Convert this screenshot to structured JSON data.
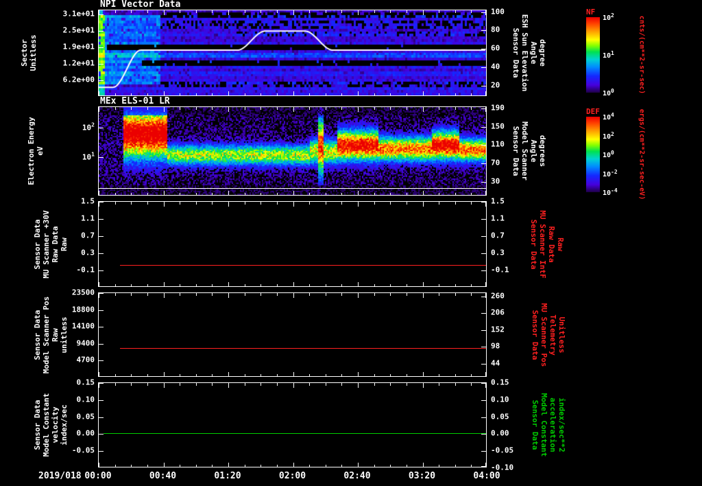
{
  "page": {
    "background": "#000000",
    "foreground": "#ffffff"
  },
  "x_axis": {
    "date_label": "2019/018",
    "tick_labels": [
      "00:00",
      "00:40",
      "01:20",
      "02:00",
      "02:40",
      "03:20",
      "04:00"
    ],
    "t_start_min": 0,
    "t_end_min": 240
  },
  "chart_data": [
    {
      "id": "npi",
      "type": "heatmap",
      "title": "NPI Vector Data",
      "left_axis": {
        "label_lines": [
          "Sector",
          "Unitless"
        ],
        "min": 0,
        "max": 32.5,
        "color": "#ffffff",
        "ticks": [
          {
            "v": 31.0,
            "label": "3.1e+01"
          },
          {
            "v": 24.8,
            "label": "2.5e+01"
          },
          {
            "v": 18.6,
            "label": "1.9e+01"
          },
          {
            "v": 12.4,
            "label": "1.2e+01"
          },
          {
            "v": 6.2,
            "label": "6.2e+00"
          }
        ]
      },
      "right_axis": {
        "label_lines": [
          "Sensor Data",
          "ESH Sun Elevation",
          "Angle",
          "degree"
        ],
        "min": 8,
        "max": 102,
        "color": "#ffffff",
        "ticks": [
          {
            "v": 100,
            "label": "100"
          },
          {
            "v": 80,
            "label": "80"
          },
          {
            "v": 60,
            "label": "60"
          },
          {
            "v": 40,
            "label": "40"
          },
          {
            "v": 20,
            "label": "20"
          }
        ]
      },
      "overlay_line": {
        "color": "#ffffff",
        "axis": "right",
        "points": [
          [
            0,
            17
          ],
          [
            9,
            17
          ],
          [
            26,
            58
          ],
          [
            86,
            58
          ],
          [
            103,
            79
          ],
          [
            128,
            79
          ],
          [
            145,
            58
          ],
          [
            240,
            58
          ]
        ]
      },
      "heatmap": {
        "rows": 32,
        "base": 0.17,
        "noise": 0.07,
        "edge_bright": {
          "t_end": 0.014,
          "boost": 0.38
        },
        "left_bright": {
          "t_end": 0.155,
          "boost": 0.2,
          "row_start": 2,
          "row_end": 28
        },
        "bright_rows": [
          {
            "r0": 0.49,
            "r1": 0.57,
            "boost": 0.16
          },
          {
            "r0": 0.72,
            "r1": 0.79,
            "boost": 0.1
          }
        ],
        "black_bands": [
          {
            "r0": 0.405,
            "r1": 0.475,
            "t0": 0.02,
            "t1": 1.0,
            "holes": 0.02
          },
          {
            "r0": 0.585,
            "r1": 0.67,
            "t0": 0.11,
            "t1": 1.0,
            "holes": 0.06
          },
          {
            "r0": 0.03,
            "r1": 0.1,
            "t0": 0.155,
            "t1": 1.0,
            "holes": 0.3
          },
          {
            "r0": 0.13,
            "r1": 0.23,
            "t0": 0.155,
            "t1": 1.0,
            "holes": 0.6
          },
          {
            "r0": 0.25,
            "r1": 0.3,
            "t0": 0.35,
            "t1": 1.0,
            "holes": 0.75
          },
          {
            "r0": 0.84,
            "r1": 0.91,
            "t0": 0.155,
            "t1": 1.0,
            "holes": 0.55
          }
        ],
        "speckle": 0.05,
        "color_scale": 0.8
      }
    },
    {
      "id": "els",
      "type": "heatmap",
      "title": "MEx ELS-01 LR",
      "left_axis": {
        "label_lines": [
          "Electron Energy",
          "eV"
        ],
        "log": true,
        "min_exp": -0.33,
        "max_exp": 2.7,
        "color": "#ffffff",
        "ticks": [
          {
            "base": "10",
            "exp": "2"
          },
          {
            "base": "10",
            "exp": "1"
          }
        ]
      },
      "right_axis": {
        "label_lines": [
          "Sensor Data",
          "Model Scanner",
          "Angle",
          "degrees"
        ],
        "min": -2,
        "max": 193,
        "color": "#ffffff",
        "ticks": [
          {
            "v": 190,
            "label": "190"
          },
          {
            "v": 150,
            "label": "150"
          },
          {
            "v": 110,
            "label": "110"
          },
          {
            "v": 70,
            "label": "70"
          },
          {
            "v": 30,
            "label": "30"
          }
        ]
      },
      "white_line": {
        "frac": 0.905,
        "color": "#ffffff"
      },
      "heatmap": {
        "bg": 0.06,
        "noise": 0.16,
        "top_dim_frac": 0.08,
        "bottom_dim_frac": 0.88,
        "segments": [
          {
            "t0": 0.0,
            "t1": 0.062,
            "amp": 0.02,
            "center": 0.5,
            "width": 0.4
          },
          {
            "t0": 0.062,
            "t1": 0.175,
            "amp": 1.05,
            "center": 0.3,
            "width": 0.26
          },
          {
            "t0": 0.175,
            "t1": 0.545,
            "amp": 0.6,
            "center": 0.54,
            "width": 0.11
          },
          {
            "t0": 0.545,
            "t1": 0.615,
            "amp": 0.66,
            "center": 0.5,
            "width": 0.13
          },
          {
            "t0": 0.563,
            "t1": 0.58,
            "amp": 0.9,
            "center": 0.45,
            "width": 0.3
          },
          {
            "t0": 0.615,
            "t1": 0.72,
            "amp": 0.97,
            "center": 0.43,
            "width": 0.16
          },
          {
            "t0": 0.72,
            "t1": 0.86,
            "amp": 0.8,
            "center": 0.47,
            "width": 0.13
          },
          {
            "t0": 0.86,
            "t1": 0.93,
            "amp": 1.0,
            "center": 0.43,
            "width": 0.15
          },
          {
            "t0": 0.93,
            "t1": 1.0,
            "amp": 0.82,
            "center": 0.48,
            "width": 0.12
          }
        ]
      }
    },
    {
      "id": "mu-scanner-30v",
      "type": "line",
      "title": "",
      "left_axis": {
        "label_lines": [
          "Sensor Data",
          "MU Scanner +30V",
          "Raw Data",
          "Raw"
        ],
        "min": -0.5,
        "max": 1.5,
        "color": "#ffffff",
        "ticks": [
          {
            "v": 1.5,
            "label": "1.5"
          },
          {
            "v": 1.1,
            "label": "1.1"
          },
          {
            "v": 0.7,
            "label": "0.7"
          },
          {
            "v": 0.3,
            "label": "0.3"
          },
          {
            "v": -0.1,
            "label": "-0.1"
          }
        ]
      },
      "right_axis": {
        "label_lines": [
          "Sensor Data",
          "MU Scanner IntF",
          "Raw Data",
          "Raw"
        ],
        "min": -0.5,
        "max": 1.5,
        "color": "#ff2020",
        "ticks": [
          {
            "v": 1.5,
            "label": "1.5"
          },
          {
            "v": 1.1,
            "label": "1.1"
          },
          {
            "v": 0.7,
            "label": "0.7"
          },
          {
            "v": 0.3,
            "label": "0.3"
          },
          {
            "v": -0.1,
            "label": "-0.1"
          }
        ]
      },
      "series": [
        {
          "name": "raw",
          "color": "#ff2020",
          "value": 0.0,
          "t_start": 13,
          "t_end": 240
        }
      ]
    },
    {
      "id": "model-scanner-pos",
      "type": "line",
      "title": "",
      "left_axis": {
        "label_lines": [
          "Sensor Data",
          "Model Scanner Pos",
          "Raw",
          "unitless"
        ],
        "min": 0,
        "max": 23500,
        "color": "#ffffff",
        "ticks": [
          {
            "v": 23500,
            "label": "23500"
          },
          {
            "v": 18800,
            "label": "18800"
          },
          {
            "v": 14100,
            "label": "14100"
          },
          {
            "v": 9400,
            "label": "9400"
          },
          {
            "v": 4700,
            "label": "4700"
          }
        ]
      },
      "right_axis": {
        "label_lines": [
          "Sensor Data",
          "MU Scanner Pos",
          "Telemetry",
          "Unitless"
        ],
        "min": 0,
        "max": 270,
        "color": "#ff2020",
        "ticks": [
          {
            "v": 260,
            "label": "260"
          },
          {
            "v": 206,
            "label": "206"
          },
          {
            "v": 152,
            "label": "152"
          },
          {
            "v": 98,
            "label": "98"
          },
          {
            "v": 44,
            "label": "44"
          }
        ]
      },
      "series": [
        {
          "name": "pos",
          "color": "#ff2020",
          "value": 8000,
          "t_start": 13,
          "t_end": 240
        }
      ]
    },
    {
      "id": "model-constant",
      "type": "line",
      "title": "",
      "left_axis": {
        "label_lines": [
          "Sensor Data",
          "Model Constant",
          "velocity",
          "index/sec"
        ],
        "min": -0.1,
        "max": 0.15,
        "color": "#ffffff",
        "ticks": [
          {
            "v": 0.15,
            "label": "0.15"
          },
          {
            "v": 0.1,
            "label": "0.10"
          },
          {
            "v": 0.05,
            "label": "0.05"
          },
          {
            "v": 0.0,
            "label": "0.00"
          },
          {
            "v": -0.05,
            "label": "-0.05"
          }
        ]
      },
      "right_axis": {
        "label_lines": [
          "Sensor Data",
          "Model Constant",
          "acceleration",
          "index/sec**2"
        ],
        "min": -0.1,
        "max": 0.15,
        "color": "#00cc00",
        "ticks": [
          {
            "v": 0.15,
            "label": "0.15"
          },
          {
            "v": 0.1,
            "label": "0.10"
          },
          {
            "v": 0.05,
            "label": "0.05"
          },
          {
            "v": 0.0,
            "label": "0.00"
          },
          {
            "v": -0.05,
            "label": "-0.05"
          },
          {
            "v": -0.1,
            "label": "-0.10"
          }
        ]
      },
      "series": [
        {
          "name": "velocity",
          "color": "#00cc00",
          "value": 0.0,
          "t_start": 3,
          "t_end": 240
        }
      ]
    }
  ],
  "colorbars": [
    {
      "title": "NF",
      "title_color": "#ff2020",
      "unit": "cnts/(cm**2-sr-sec)",
      "unit_color": "#ff2020",
      "tick_color": "#ffffff",
      "ticks": [
        {
          "base": "10",
          "exp": "2"
        },
        {
          "base": "10",
          "exp": "1"
        },
        {
          "base": "10",
          "exp": "0"
        }
      ]
    },
    {
      "title": "DEF",
      "title_color": "#ff2020",
      "unit": "ergs/(cm**2-sr-sec-eV)",
      "unit_color": "#ff2020",
      "tick_color": "#ffffff",
      "ticks": [
        {
          "base": "10",
          "exp": "4"
        },
        {
          "base": "10",
          "exp": "2"
        },
        {
          "base": "10",
          "exp": "0"
        },
        {
          "base": "10",
          "exp": "-2"
        },
        {
          "base": "10",
          "exp": "-4"
        }
      ]
    }
  ],
  "colormap_stops": [
    [
      0.0,
      30,
      0,
      70
    ],
    [
      0.1,
      70,
      0,
      220
    ],
    [
      0.22,
      20,
      40,
      255
    ],
    [
      0.34,
      0,
      140,
      255
    ],
    [
      0.44,
      0,
      210,
      210
    ],
    [
      0.54,
      0,
      225,
      80
    ],
    [
      0.62,
      130,
      255,
      0
    ],
    [
      0.7,
      255,
      255,
      0
    ],
    [
      0.82,
      255,
      150,
      0
    ],
    [
      0.92,
      255,
      60,
      0
    ],
    [
      1.0,
      235,
      0,
      0
    ]
  ]
}
